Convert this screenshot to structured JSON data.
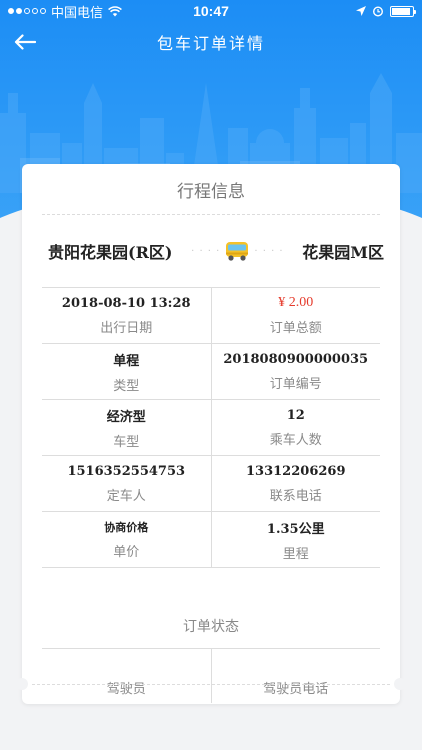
{
  "status_bar": {
    "carrier": "中国电信",
    "time": "10:47"
  },
  "nav": {
    "title": "包车订单详情"
  },
  "card": {
    "title": "行程信息",
    "route": {
      "from": "贵阳花果园(R区)",
      "to": "花果园M区"
    },
    "details": [
      [
        {
          "value": "2018-08-10 13:28",
          "label": "出行日期"
        },
        {
          "value": "¥ 2.00",
          "label": "订单总额"
        }
      ],
      [
        {
          "value": "单程",
          "label": "类型"
        },
        {
          "value": "2018080900000035",
          "label": "订单编号"
        }
      ],
      [
        {
          "value": "经济型",
          "label": "车型"
        },
        {
          "value": "12",
          "label": "乘车人数"
        }
      ],
      [
        {
          "value": "15163525547​53",
          "label": "定车人"
        },
        {
          "value": "13312206269",
          "label": "联系电话"
        }
      ],
      [
        {
          "value": "协商价格",
          "label": "单价"
        },
        {
          "value": "1.35公里",
          "label": "里程"
        }
      ]
    ],
    "order_status_title": "订单状态",
    "driver": {
      "driver_label": "驾驶员",
      "phone_label": "驾驶员电话"
    }
  },
  "colors": {
    "header_blue": "#1c8df5",
    "price_red": "#e53b2c"
  },
  "icons": {
    "back": "arrow-left-icon",
    "vehicle": "bus-icon"
  }
}
